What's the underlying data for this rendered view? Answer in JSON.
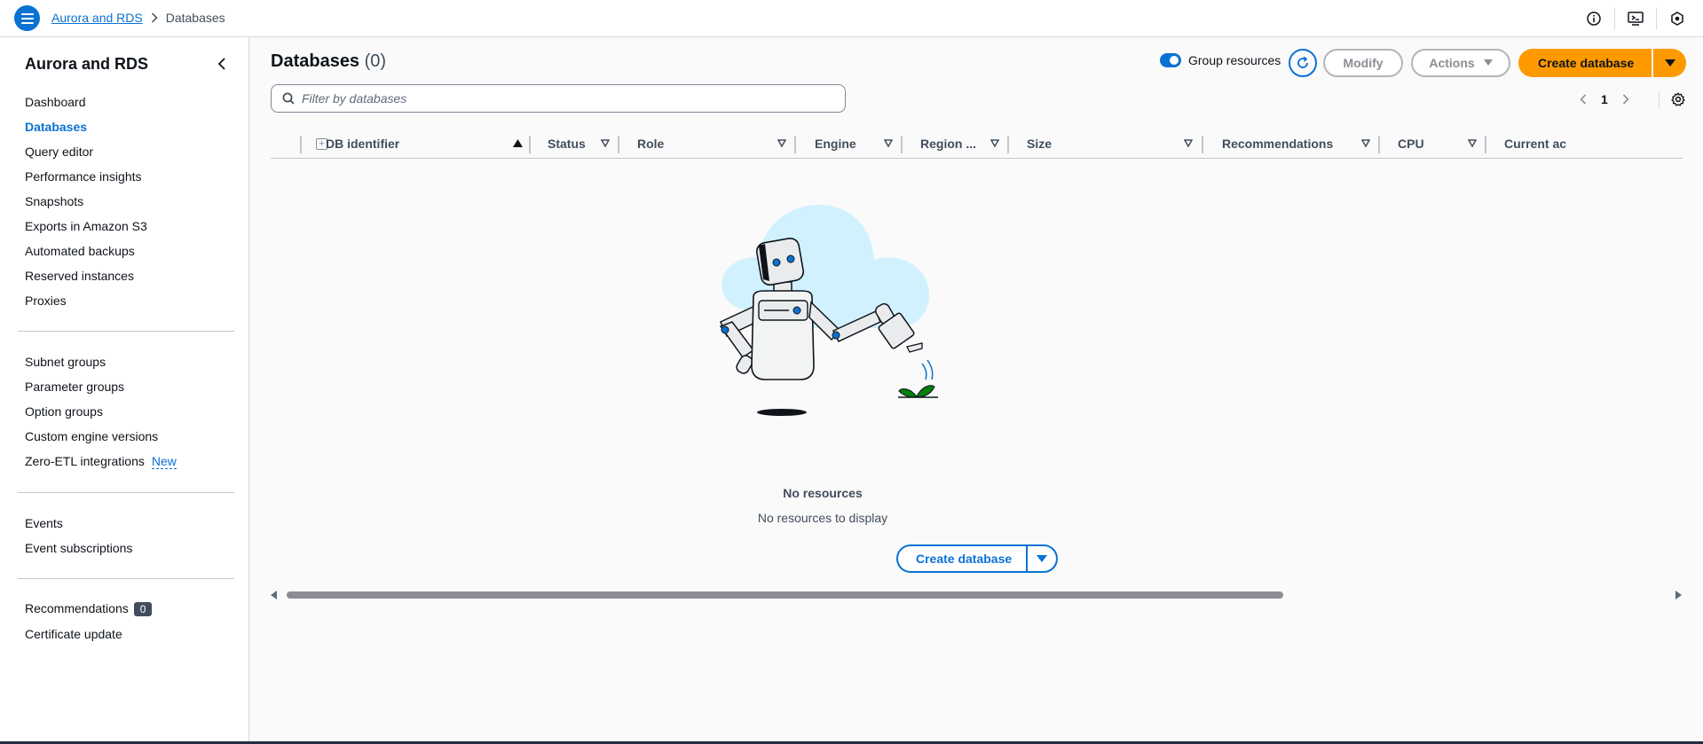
{
  "breadcrumb": {
    "root": "Aurora and RDS",
    "current": "Databases"
  },
  "sidebar": {
    "title": "Aurora and RDS",
    "group1": [
      "Dashboard",
      "Databases",
      "Query editor",
      "Performance insights",
      "Snapshots",
      "Exports in Amazon S3",
      "Automated backups",
      "Reserved instances",
      "Proxies"
    ],
    "group2": [
      "Subnet groups",
      "Parameter groups",
      "Option groups",
      "Custom engine versions",
      "Zero-ETL integrations"
    ],
    "new_badge": "New",
    "group3": [
      "Events",
      "Event subscriptions"
    ],
    "recommendations": "Recommendations",
    "recommendations_count": "0",
    "certificate_update": "Certificate update"
  },
  "main": {
    "title": "Databases",
    "count": "(0)",
    "group_resources": "Group resources",
    "modify": "Modify",
    "actions": "Actions",
    "create_database": "Create database",
    "filter_placeholder": "Filter by databases",
    "page": "1",
    "columns": [
      "DB identifier",
      "Status",
      "Role",
      "Engine",
      "Region ...",
      "Size",
      "Recommendations",
      "CPU",
      "Current act"
    ],
    "empty_title": "No resources",
    "empty_subtitle": "No resources to display",
    "empty_button": "Create database"
  },
  "colors": {
    "accent": "#0972d3",
    "primary": "#ff9900"
  }
}
